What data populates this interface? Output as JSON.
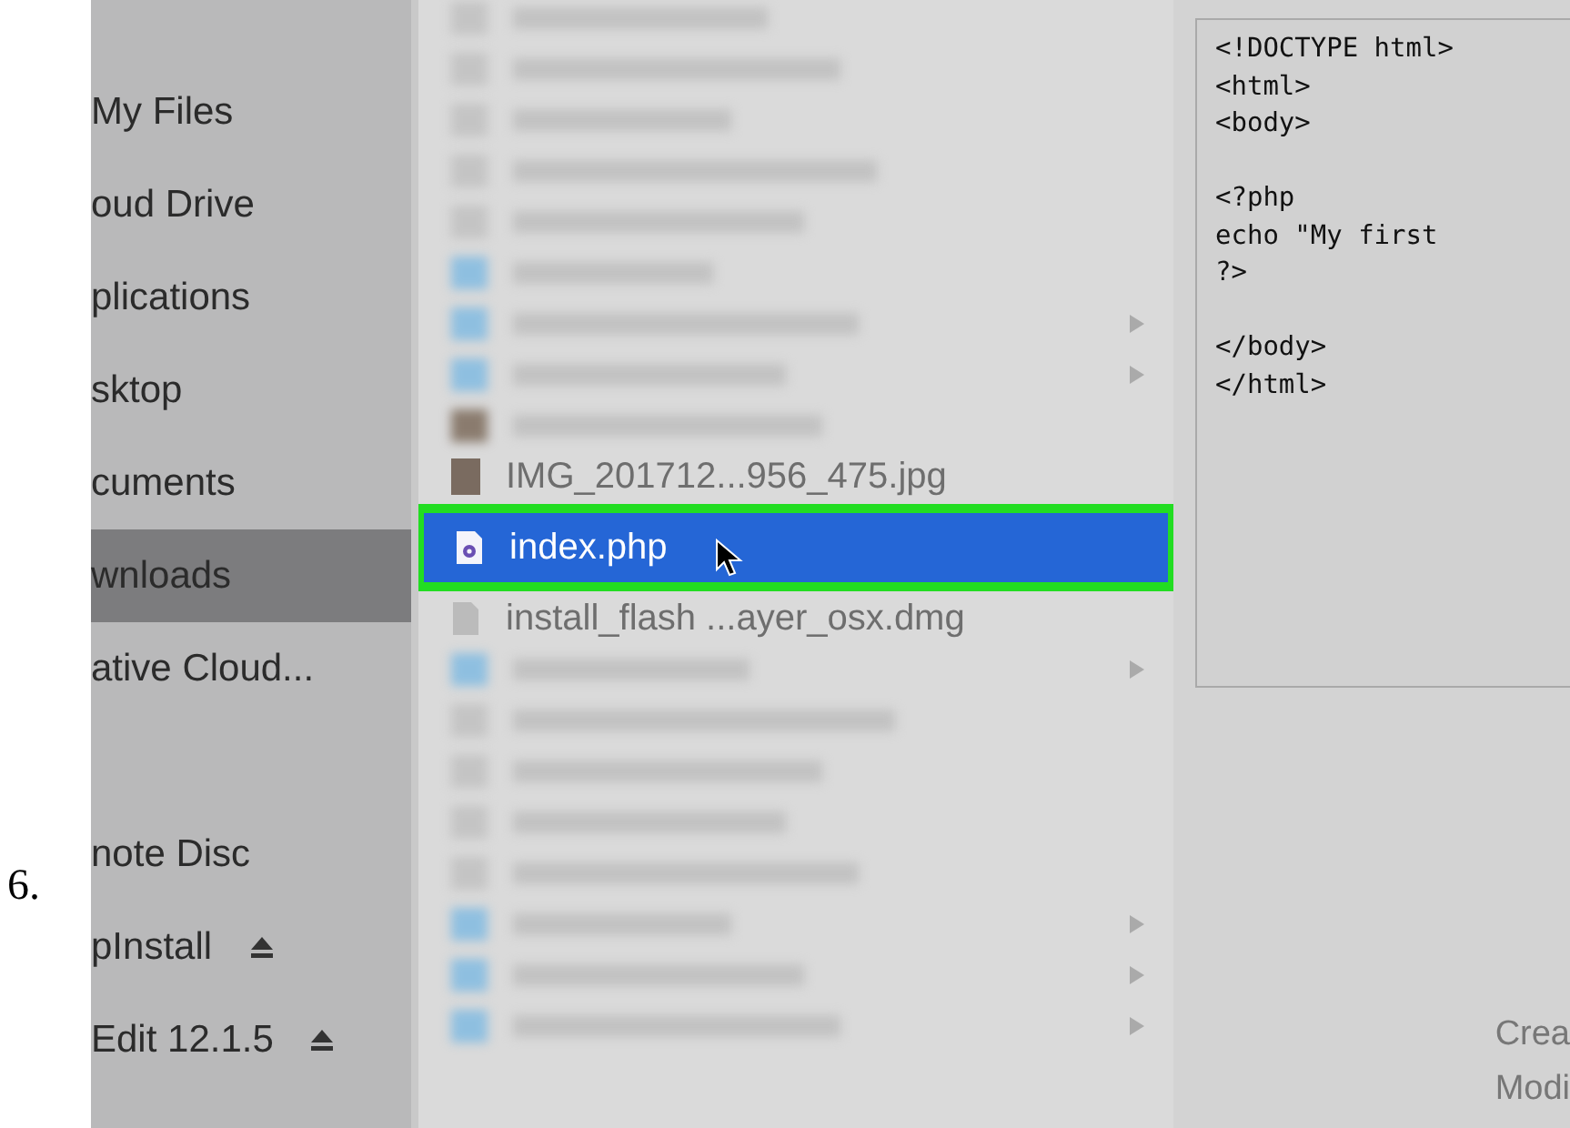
{
  "step_number": "6.",
  "sidebar": {
    "groups": [
      {
        "items": [
          {
            "label": "My Files",
            "selected": false,
            "eject": false
          },
          {
            "label": "oud Drive",
            "selected": false,
            "eject": false
          },
          {
            "label": "plications",
            "selected": false,
            "eject": false
          },
          {
            "label": "sktop",
            "selected": false,
            "eject": false
          },
          {
            "label": "cuments",
            "selected": false,
            "eject": false
          },
          {
            "label": "wnloads",
            "selected": true,
            "eject": false
          },
          {
            "label": "ative Cloud...",
            "selected": false,
            "eject": false
          }
        ]
      },
      {
        "items": [
          {
            "label": "note Disc",
            "selected": false,
            "eject": false
          },
          {
            "label": "pInstall",
            "selected": false,
            "eject": true
          },
          {
            "label": "Edit 12.1.5",
            "selected": false,
            "eject": true
          }
        ]
      }
    ]
  },
  "file_list": {
    "rows": [
      {
        "kind": "blurred_file"
      },
      {
        "kind": "blurred_file"
      },
      {
        "kind": "blurred_file"
      },
      {
        "kind": "blurred_file"
      },
      {
        "kind": "blurred_file"
      },
      {
        "kind": "blurred_folder"
      },
      {
        "kind": "blurred_subfolder"
      },
      {
        "kind": "blurred_subfolder"
      },
      {
        "kind": "blurred_image"
      },
      {
        "kind": "image_file",
        "name": "IMG_201712...956_475.jpg",
        "selected": false
      },
      {
        "kind": "php_file",
        "name": "index.php",
        "selected": true
      },
      {
        "kind": "file",
        "name": "install_flash ...ayer_osx.dmg",
        "selected": false
      },
      {
        "kind": "blurred_subfolder"
      },
      {
        "kind": "blurred_file"
      },
      {
        "kind": "blurred_file"
      },
      {
        "kind": "blurred_file"
      },
      {
        "kind": "blurred_file"
      },
      {
        "kind": "blurred_subfolder"
      },
      {
        "kind": "blurred_subfolder"
      },
      {
        "kind": "blurred_subfolder"
      }
    ]
  },
  "preview": {
    "code": "<!DOCTYPE html>\n<html>\n<body>\n\n<?php\necho \"My first\n?>\n\n</body>\n</html>",
    "info_labels": [
      "Crea",
      "Modi"
    ]
  }
}
